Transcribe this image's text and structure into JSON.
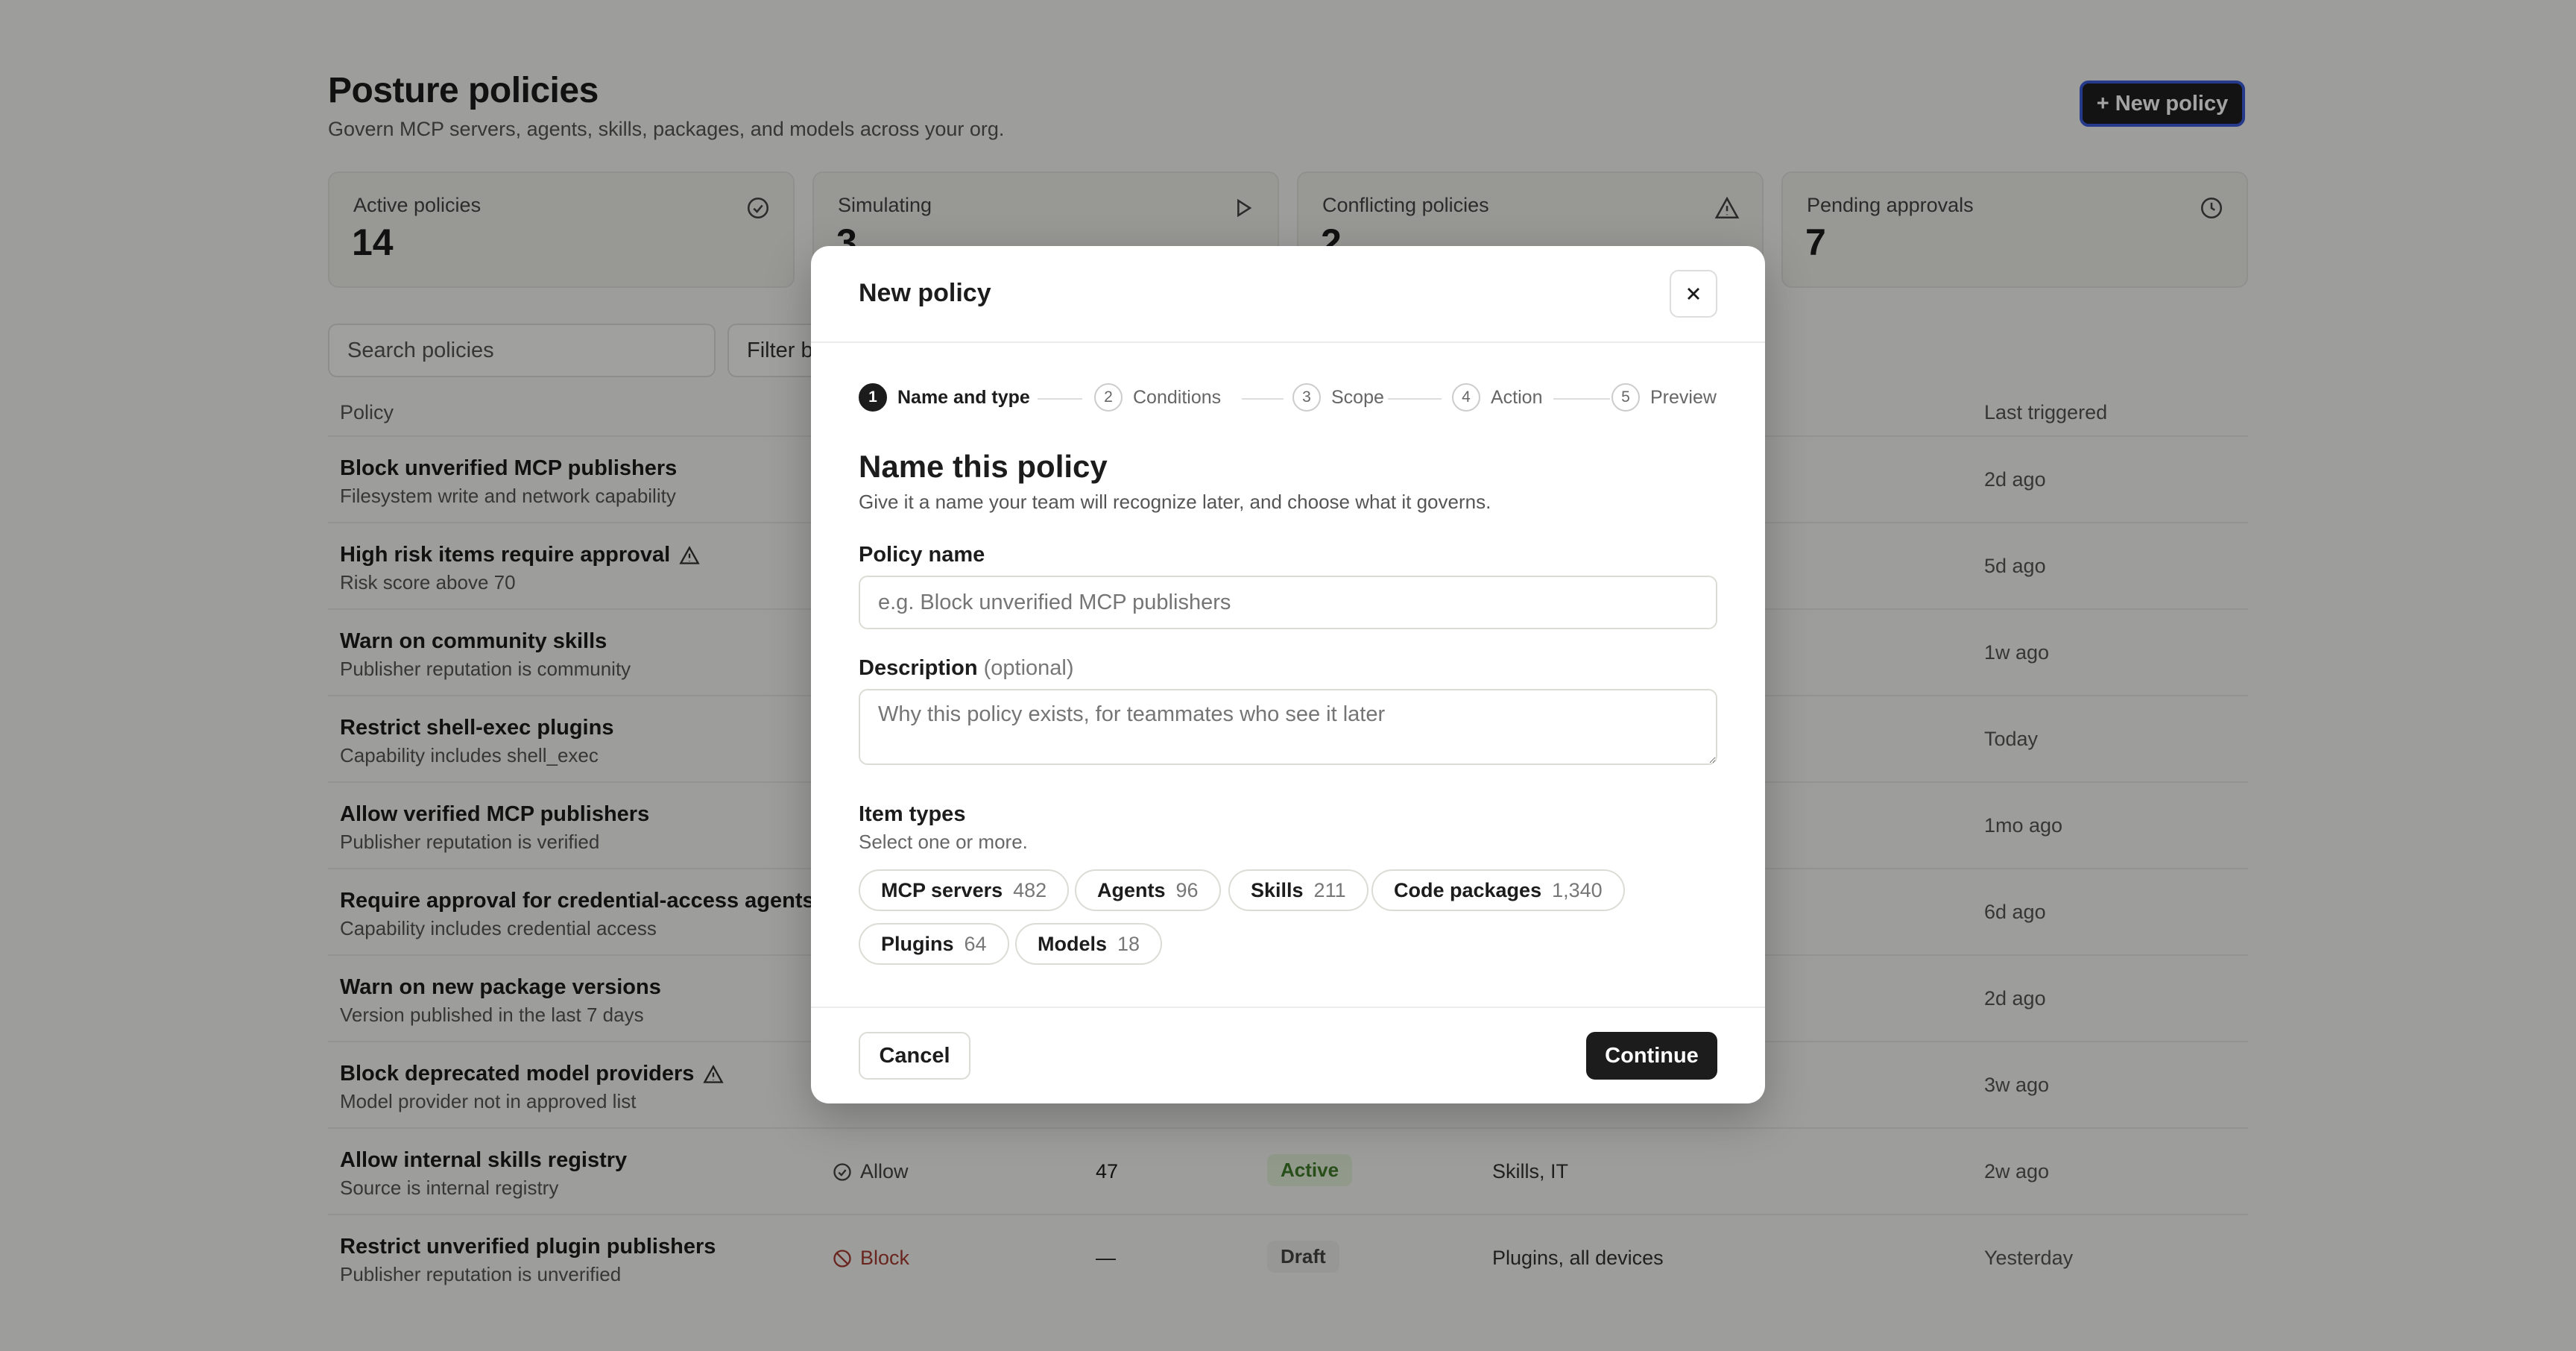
{
  "page": {
    "title": "Posture policies",
    "subtitle": "Govern MCP servers, agents, skills, packages, and models across your org.",
    "new_policy_label": "+ New policy"
  },
  "stats": [
    {
      "label": "Active policies",
      "value": "14",
      "icon": "check-circle-icon"
    },
    {
      "label": "Simulating",
      "value": "3",
      "icon": "play-icon"
    },
    {
      "label": "Conflicting policies",
      "value": "2",
      "icon": "warning-triangle-icon"
    },
    {
      "label": "Pending approvals",
      "value": "7",
      "icon": "clock-icon"
    }
  ],
  "toolbar": {
    "search_placeholder": "Search policies",
    "filter_label": "Filter b"
  },
  "table": {
    "headers": {
      "policy": "Policy",
      "last_triggered": "Last triggered"
    },
    "rows": [
      {
        "name": "Block unverified MCP publishers",
        "desc": "Filesystem write and network capability",
        "last": "2d ago",
        "warning": false
      },
      {
        "name": "High risk items require approval",
        "desc": "Risk score above 70",
        "last": "5d ago",
        "warning": true
      },
      {
        "name": "Warn on community skills",
        "desc": "Publisher reputation is community",
        "last": "1w ago",
        "warning": false
      },
      {
        "name": "Restrict shell-exec plugins",
        "desc": "Capability includes shell_exec",
        "last": "Today",
        "warning": false
      },
      {
        "name": "Allow verified MCP publishers",
        "desc": "Publisher reputation is verified",
        "last": "1mo ago",
        "warning": false
      },
      {
        "name": "Require approval for credential-access agents",
        "desc": "Capability includes credential access",
        "last": "6d ago",
        "warning": false
      },
      {
        "name": "Warn on new package versions",
        "desc": "Version published in the last 7 days",
        "last": "2d ago",
        "warning": false
      },
      {
        "name": "Block deprecated model providers",
        "desc": "Model provider not in approved list",
        "last": "3w ago",
        "warning": true
      },
      {
        "name": "Allow internal skills registry",
        "desc": "Source is internal registry",
        "last": "2w ago",
        "warning": false,
        "action": "Allow",
        "count": "47",
        "status": "Active",
        "scope": "Skills, IT"
      },
      {
        "name": "Restrict unverified plugin publishers",
        "desc": "Publisher reputation is unverified",
        "last": "Yesterday",
        "warning": false,
        "action": "Block",
        "count": "—",
        "status": "Draft",
        "scope": "Plugins, all devices"
      }
    ]
  },
  "modal": {
    "title": "New policy",
    "steps": [
      {
        "num": "1",
        "label": "Name and type"
      },
      {
        "num": "2",
        "label": "Conditions"
      },
      {
        "num": "3",
        "label": "Scope"
      },
      {
        "num": "4",
        "label": "Action"
      },
      {
        "num": "5",
        "label": "Preview"
      }
    ],
    "section_title": "Name this policy",
    "section_sub": "Give it a name your team will recognize later, and choose what it governs.",
    "policy_name_label": "Policy name",
    "policy_name_placeholder": "e.g. Block unverified MCP publishers",
    "description_label": "Description",
    "description_optional": "(optional)",
    "description_placeholder": "Why this policy exists, for teammates who see it later",
    "item_types_label": "Item types",
    "item_types_sub": "Select one or more.",
    "item_types": [
      {
        "name": "MCP servers",
        "count": "482"
      },
      {
        "name": "Agents",
        "count": "96"
      },
      {
        "name": "Skills",
        "count": "211"
      },
      {
        "name": "Code packages",
        "count": "1,340"
      },
      {
        "name": "Plugins",
        "count": "64"
      },
      {
        "name": "Models",
        "count": "18"
      }
    ],
    "cancel_label": "Cancel",
    "continue_label": "Continue"
  },
  "colors": {
    "accent": "#1c1c1c",
    "focus_ring": "#3b5bd9",
    "active_status": "#3f7a2a",
    "block_status": "#a43a2f"
  }
}
